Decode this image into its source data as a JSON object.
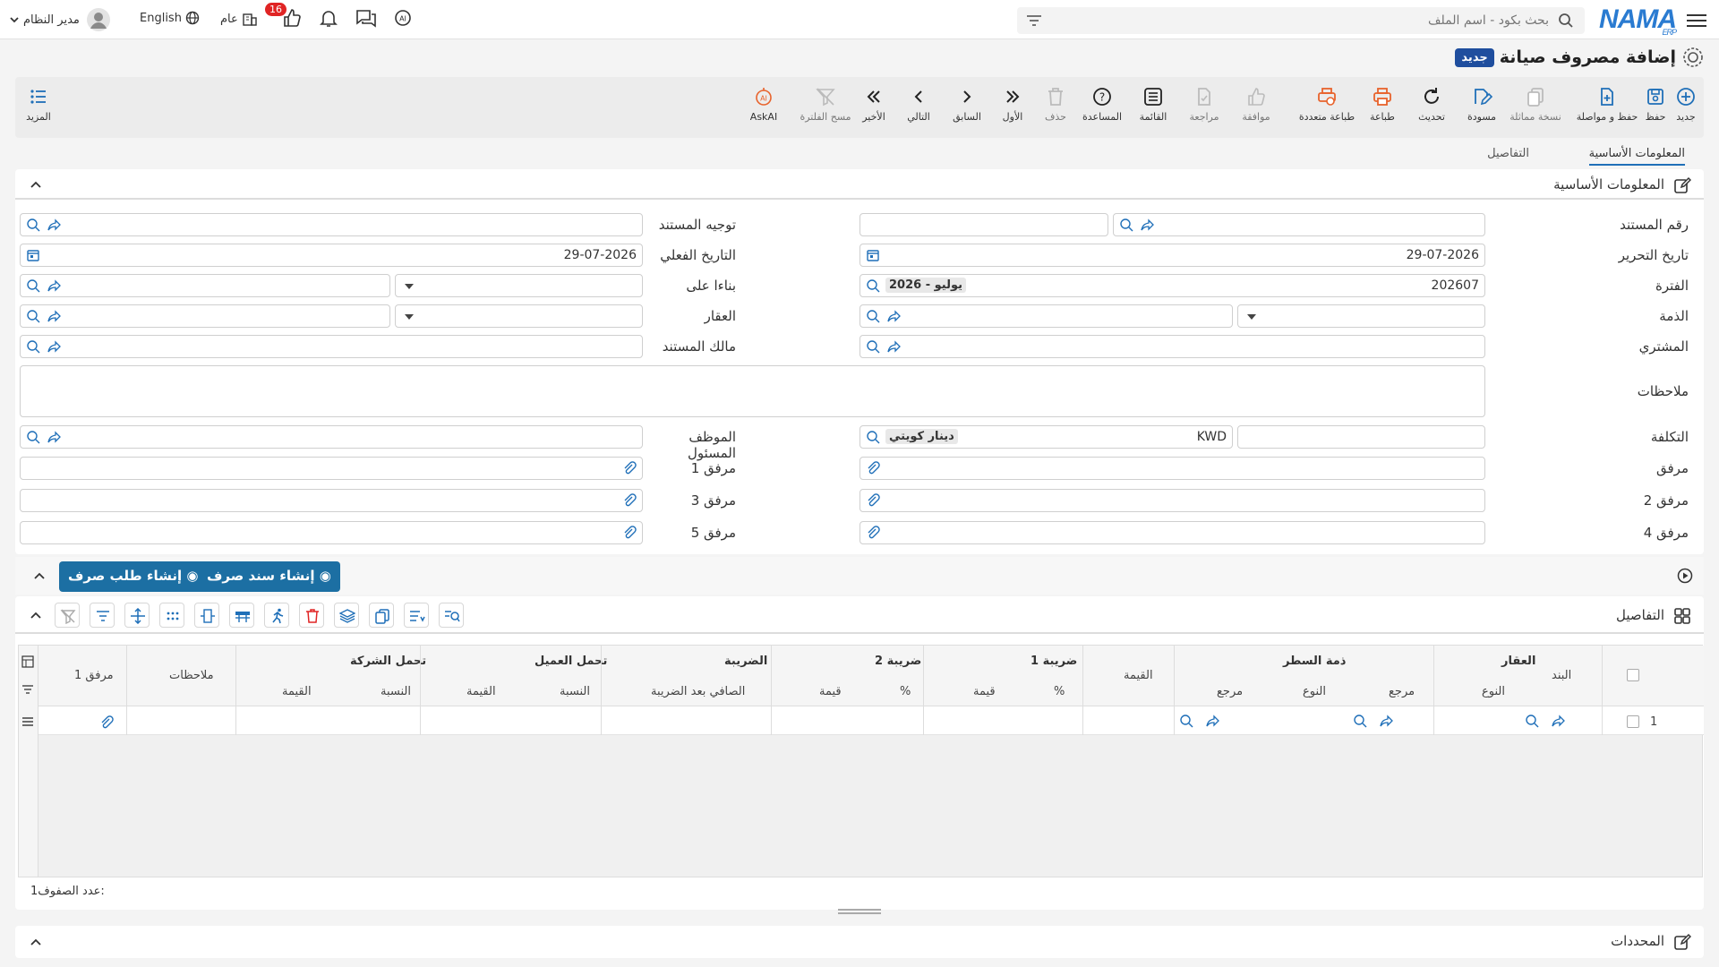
{
  "header": {
    "logo_text": "NAMA",
    "logo_sub": "ERP",
    "search_placeholder": "بحث بكود - اسم الملف",
    "user_name": "مدير النظام",
    "language": "English",
    "company": "عام",
    "notification_count": "16"
  },
  "page": {
    "title": "إضافة مصروف صيانة",
    "mode_badge": "جديد"
  },
  "toolbar": {
    "new": "جديد",
    "save": "حفظ",
    "save_continue": "حفظ و مواصلة",
    "copy": "نسخة مماثلة",
    "draft": "مسودة",
    "refresh": "تحديث",
    "print": "طباعة",
    "multi_print": "طباعة متعددة",
    "approve": "موافقة",
    "review": "مراجعة",
    "list": "القائمة",
    "help": "المساعدة",
    "delete": "حذف",
    "first": "الأول",
    "previous": "السابق",
    "next": "التالي",
    "last": "الأخير",
    "clear_filter": "مسح الفلترة",
    "ask_ai": "AskAI",
    "more": "المزيد"
  },
  "tabs": {
    "basic": "المعلومات الأساسية",
    "details": "التفاصيل"
  },
  "basic_section": {
    "title": "المعلومات الأساسية",
    "labels": {
      "doc_number": "رقم المستند",
      "doc_direction": "توجيه المستند",
      "edit_date": "تاريخ التحرير",
      "actual_date": "التاريخ الفعلي",
      "period": "الفترة",
      "based_on": "بناءا على",
      "account": "الذمة",
      "property": "العقار",
      "buyer": "المشتري",
      "doc_owner": "مالك المستند",
      "notes": "ملاحظات",
      "cost": "التكلفة",
      "responsible": "الموظف المسئول",
      "attachment": "مرفق",
      "attachment1": "مرفق 1",
      "attachment2": "مرفق 2",
      "attachment3": "مرفق 3",
      "attachment4": "مرفق 4",
      "attachment5": "مرفق 5"
    },
    "values": {
      "edit_date": "29-07-2026",
      "actual_date": "29-07-2026",
      "period_code": "202607",
      "period_name": "2026 - يوليو",
      "currency_code": "KWD",
      "currency_name": "دينار كويتي"
    }
  },
  "actions": {
    "create_payment_voucher": "إنشاء سند صرف",
    "create_payment_request": "إنشاء طلب صرف"
  },
  "details_section": {
    "title": "التفاصيل",
    "group_headers": {
      "property": "العقار",
      "line_account": "ذمة السطر",
      "tax1": "ضريبة 1",
      "tax2": "ضريبة 2",
      "tax": "الضريبة",
      "customer_share": "تحمل العميل",
      "company_share": "تحمل الشركة"
    },
    "columns": {
      "item": "البند",
      "type": "النوع",
      "ref": "مرجع",
      "value": "القيمة",
      "percent": "%",
      "amount": "قيمة",
      "net_after_tax": "الصافي بعد الضريبة",
      "ratio": "النسبة",
      "notes": "ملاحظات",
      "attachment1": "مرفق 1"
    },
    "rows": [
      {
        "index": "1"
      }
    ],
    "row_count_label": "عدد الصفوف:",
    "row_count": "1"
  },
  "filters_section": {
    "title": "المحددات"
  },
  "colors": {
    "primary": "#1f4e9e",
    "action_button": "#1c6fa3",
    "orange_icon": "#e8632c",
    "badge_red": "#e02424"
  }
}
